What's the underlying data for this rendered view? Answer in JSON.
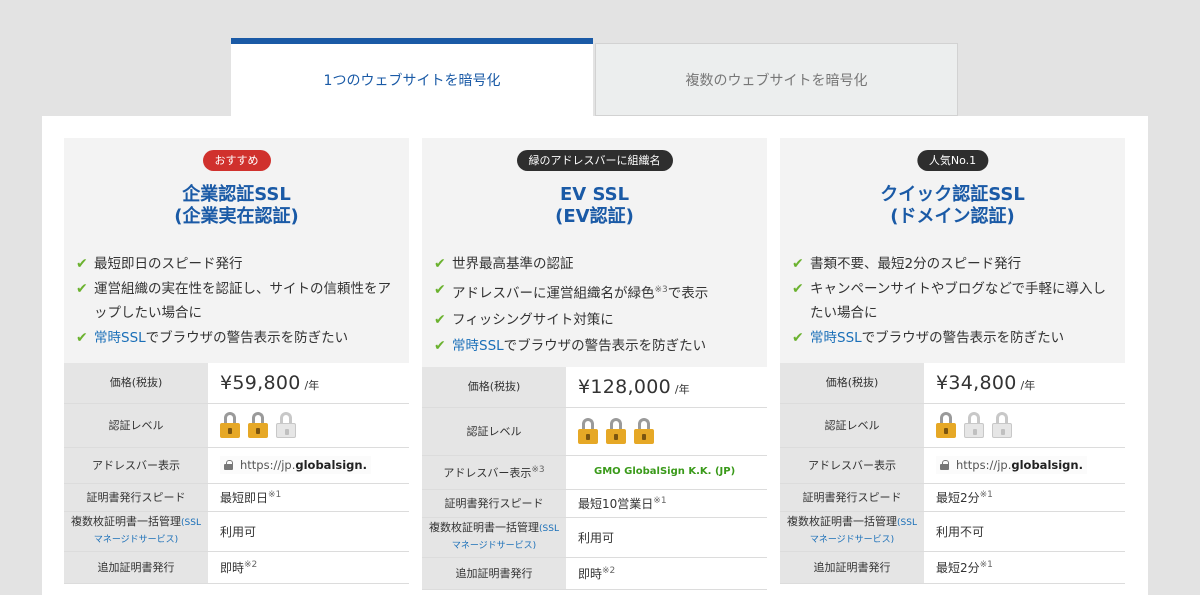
{
  "tabs": [
    {
      "label": "1つのウェブサイトを暗号化",
      "active": true
    },
    {
      "label": "複数のウェブサイトを暗号化",
      "active": false
    }
  ],
  "colors": {
    "accent": "#1a5aa6",
    "check": "#6bb22f",
    "badge_red": "#d0312d",
    "badge_dark": "#2e2e2e",
    "ev_green": "#3a9a1a"
  },
  "cards": [
    {
      "badge": "おすすめ",
      "title_line1": "企業認証SSL",
      "title_line2": "(企業実在認証)",
      "features": [
        {
          "text": "最短即日のスピード発行"
        },
        {
          "text": "運営組織の実在性を認証し、サイトの信頼性をアップしたい場合に"
        },
        {
          "link": "常時SSL",
          "text": "でブラウザの警告表示を防ぎたい"
        }
      ],
      "labels": {
        "price": "価格(税抜)",
        "level": "認証レベル",
        "address": "アドレスバー表示",
        "speed": "証明書発行スピード",
        "multi": "複数枚証明書一括管理",
        "multi_link": "(SSLマネージドサービス)",
        "additional": "追加証明書発行"
      },
      "price": "¥59,800",
      "price_unit": "/年",
      "level_locks": 2,
      "address_prefix": "https://jp.",
      "address_domain": "globalsign.",
      "speed": "最短即日",
      "speed_note": "※1",
      "multi": "利用可",
      "additional": "即時",
      "additional_note": "※2"
    },
    {
      "badge": "緑のアドレスバーに組織名",
      "title_line1": "EV SSL",
      "title_line2": "(EV認証)",
      "features": [
        {
          "text": "世界最高基準の認証"
        },
        {
          "text": "アドレスバーに運営組織名が緑色",
          "note": "※3",
          "text2": "で表示"
        },
        {
          "text": "フィッシングサイト対策に"
        },
        {
          "link": "常時SSL",
          "text": "でブラウザの警告表示を防ぎたい"
        }
      ],
      "labels": {
        "price": "価格(税抜)",
        "level": "認証レベル",
        "address": "アドレスバー表示",
        "address_note": "※3",
        "speed": "証明書発行スピード",
        "multi": "複数枚証明書一括管理",
        "multi_link": "(SSLマネージドサービス)",
        "additional": "追加証明書発行"
      },
      "price": "¥128,000",
      "price_unit": "/年",
      "level_locks": 3,
      "address_ev": "GMO GlobalSign K.K. (JP)",
      "speed": "最短10営業日",
      "speed_note": "※1",
      "multi": "利用可",
      "additional": "即時",
      "additional_note": "※2"
    },
    {
      "badge": "人気No.1",
      "title_line1": "クイック認証SSL",
      "title_line2": "(ドメイン認証)",
      "features": [
        {
          "text": "書類不要、最短2分のスピード発行"
        },
        {
          "text": "キャンペーンサイトやブログなどで手軽に導入したい場合に"
        },
        {
          "link": "常時SSL",
          "text": "でブラウザの警告表示を防ぎたい"
        }
      ],
      "labels": {
        "price": "価格(税抜)",
        "level": "認証レベル",
        "address": "アドレスバー表示",
        "speed": "証明書発行スピード",
        "multi": "複数枚証明書一括管理",
        "multi_link": "(SSLマネージドサービス)",
        "additional": "追加証明書発行"
      },
      "price": "¥34,800",
      "price_unit": "/年",
      "level_locks": 1,
      "address_prefix": "https://jp.",
      "address_domain": "globalsign.",
      "speed": "最短2分",
      "speed_note": "※1",
      "multi": "利用不可",
      "additional": "最短2分",
      "additional_note": "※1"
    }
  ]
}
